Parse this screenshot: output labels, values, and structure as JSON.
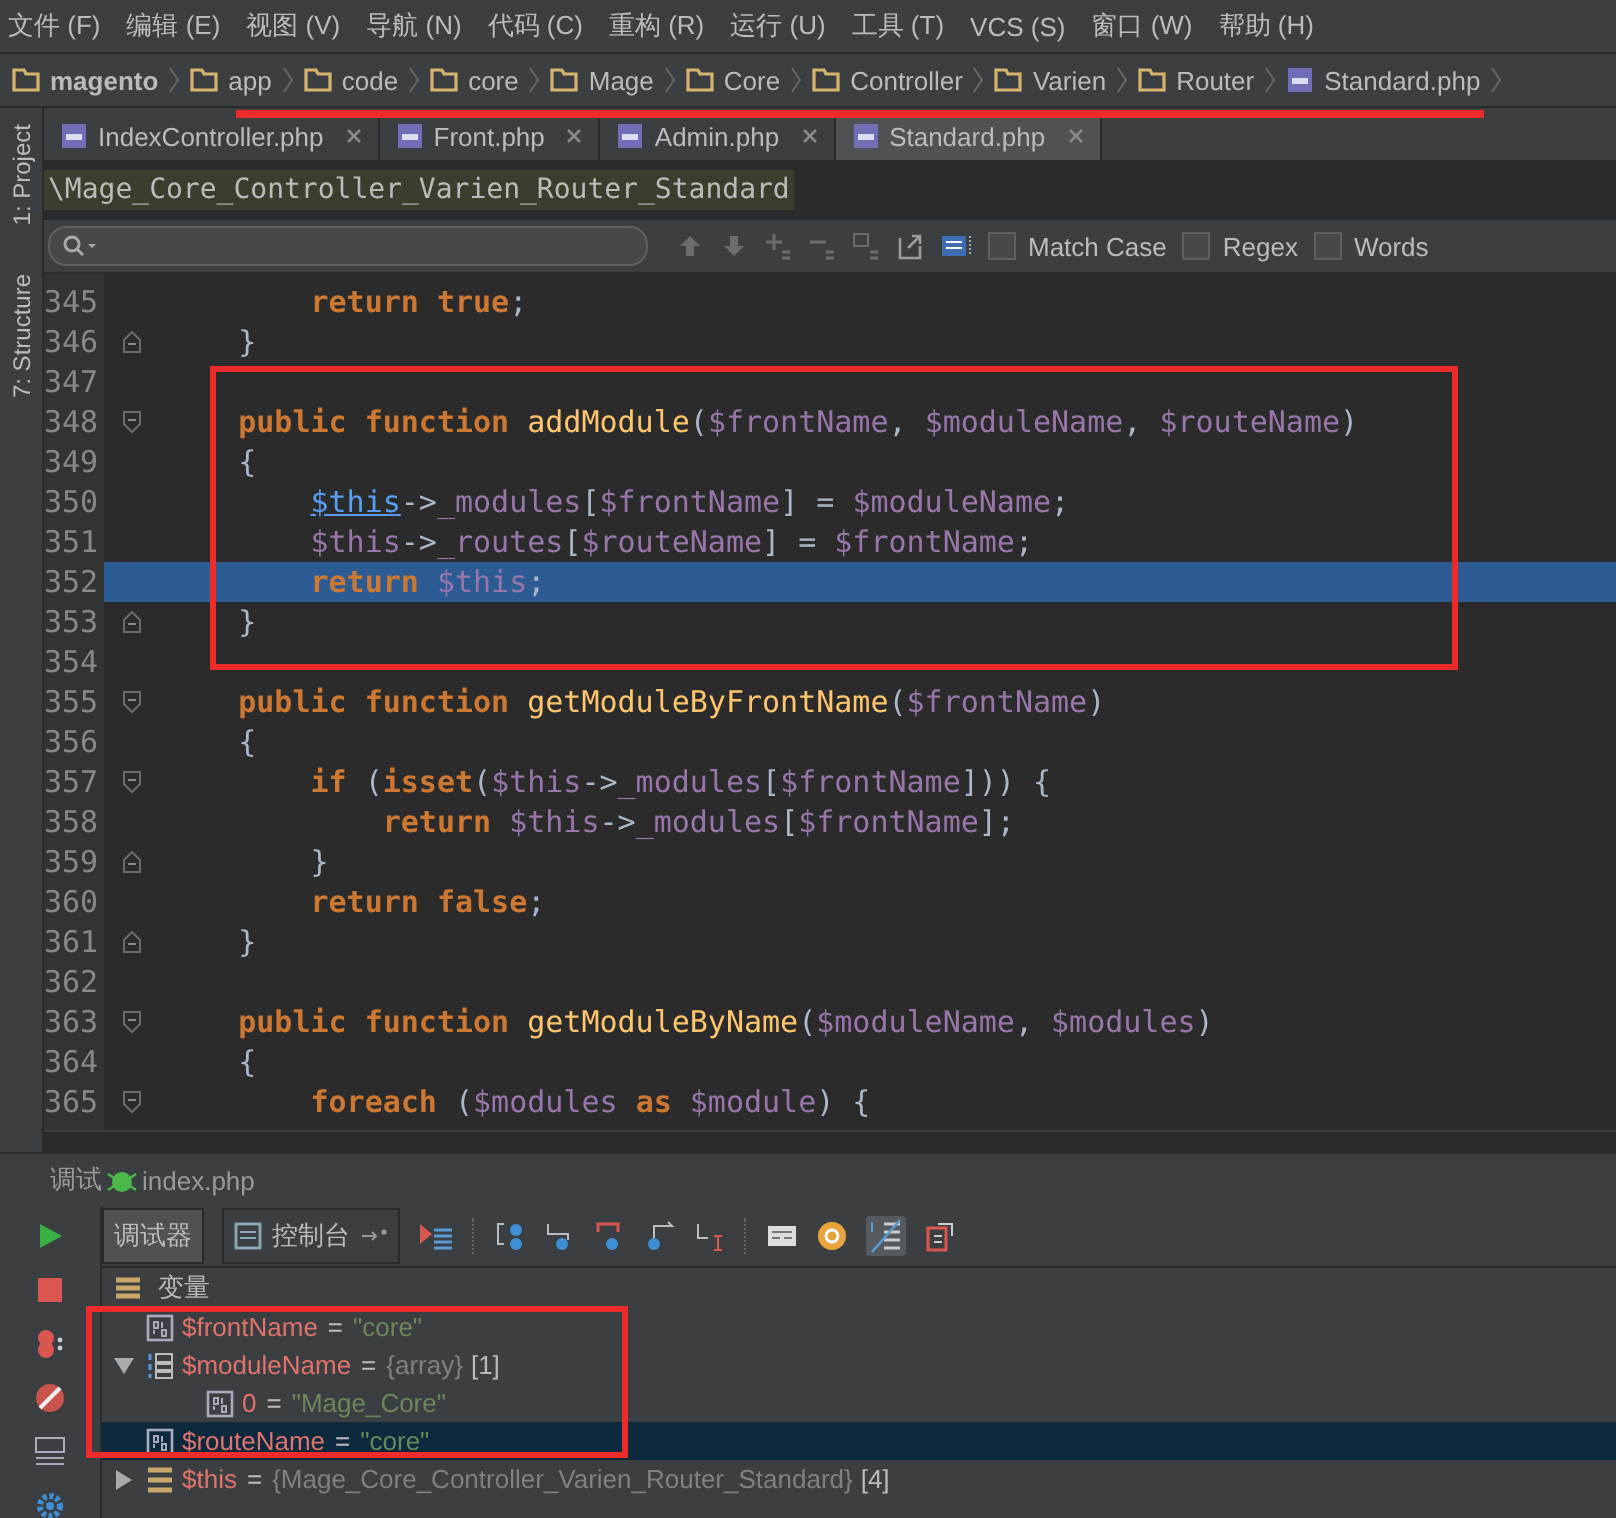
{
  "menu": [
    "文件 (F)",
    "编辑 (E)",
    "视图 (V)",
    "导航 (N)",
    "代码 (C)",
    "重构 (R)",
    "运行 (U)",
    "工具 (T)",
    "VCS (S)",
    "窗口 (W)",
    "帮助 (H)"
  ],
  "breadcrumbs": [
    {
      "label": "magento",
      "kind": "folder"
    },
    {
      "label": "app",
      "kind": "folder"
    },
    {
      "label": "code",
      "kind": "folder"
    },
    {
      "label": "core",
      "kind": "folder"
    },
    {
      "label": "Mage",
      "kind": "folder"
    },
    {
      "label": "Core",
      "kind": "folder"
    },
    {
      "label": "Controller",
      "kind": "folder"
    },
    {
      "label": "Varien",
      "kind": "folder"
    },
    {
      "label": "Router",
      "kind": "folder"
    },
    {
      "label": "Standard.php",
      "kind": "php"
    }
  ],
  "tool_windows": [
    "1: Project",
    "7: Structure"
  ],
  "tabs": [
    {
      "label": "IndexController.php",
      "selected": false
    },
    {
      "label": "Front.php",
      "selected": false
    },
    {
      "label": "Admin.php",
      "selected": false
    },
    {
      "label": "Standard.php",
      "selected": true
    }
  ],
  "class_path": "\\Mage_Core_Controller_Varien_Router_Standard",
  "find_options": [
    {
      "label": "Match Case",
      "checked": false
    },
    {
      "label": "Regex",
      "checked": false
    },
    {
      "label": "Words",
      "checked": false
    }
  ],
  "code": [
    {
      "number": "345",
      "current": false,
      "tokens": [
        {
          "kind": "kw",
          "text": "        return "
        },
        {
          "kind": "kw",
          "text": "true"
        },
        {
          "kind": "plain",
          "text": ";"
        }
      ]
    },
    {
      "number": "346",
      "current": false,
      "fold_end": true,
      "tokens": [
        {
          "kind": "plain",
          "text": "    }"
        }
      ]
    },
    {
      "number": "347",
      "current": false
    },
    {
      "number": "348",
      "current": false,
      "fold_start": true,
      "tokens": [
        {
          "kind": "kw",
          "text": "    public "
        },
        {
          "kind": "kw",
          "text": "function "
        },
        {
          "kind": "fn",
          "text": "addModule"
        },
        {
          "kind": "plain",
          "text": "("
        },
        {
          "kind": "var",
          "text": "$frontName"
        },
        {
          "kind": "plain",
          "text": ", "
        },
        {
          "kind": "var",
          "text": "$moduleName"
        },
        {
          "kind": "plain",
          "text": ", "
        },
        {
          "kind": "var",
          "text": "$routeName"
        },
        {
          "kind": "plain",
          "text": ")"
        }
      ]
    },
    {
      "number": "349",
      "current": false,
      "tokens": [
        {
          "kind": "plain",
          "text": "    {"
        }
      ]
    },
    {
      "number": "350",
      "current": false,
      "tokens": [
        {
          "kind": "link",
          "text": "        $this"
        },
        {
          "kind": "plain",
          "text": "->"
        },
        {
          "kind": "var",
          "text": "_modules"
        },
        {
          "kind": "plain",
          "text": "["
        },
        {
          "kind": "var",
          "text": "$frontName"
        },
        {
          "kind": "plain",
          "text": "] = "
        },
        {
          "kind": "var",
          "text": "$moduleName"
        },
        {
          "kind": "plain",
          "text": ";"
        }
      ]
    },
    {
      "number": "351",
      "current": false,
      "tokens": [
        {
          "kind": "var",
          "text": "        $this"
        },
        {
          "kind": "plain",
          "text": "->"
        },
        {
          "kind": "var",
          "text": "_routes"
        },
        {
          "kind": "plain",
          "text": "["
        },
        {
          "kind": "var",
          "text": "$routeName"
        },
        {
          "kind": "plain",
          "text": "] = "
        },
        {
          "kind": "var",
          "text": "$frontName"
        },
        {
          "kind": "plain",
          "text": ";"
        }
      ]
    },
    {
      "number": "352",
      "current": true,
      "tokens": [
        {
          "kind": "kw",
          "text": "        return "
        },
        {
          "kind": "var",
          "text": "$this"
        },
        {
          "kind": "plain",
          "text": ";"
        }
      ]
    },
    {
      "number": "353",
      "current": false,
      "fold_end": true,
      "tokens": [
        {
          "kind": "plain",
          "text": "    }"
        }
      ]
    },
    {
      "number": "354",
      "current": false
    },
    {
      "number": "355",
      "current": false,
      "fold_start": true,
      "tokens": [
        {
          "kind": "kw",
          "text": "    public "
        },
        {
          "kind": "kw",
          "text": "function "
        },
        {
          "kind": "fn",
          "text": "getModuleByFrontName"
        },
        {
          "kind": "plain",
          "text": "("
        },
        {
          "kind": "var",
          "text": "$frontName"
        },
        {
          "kind": "plain",
          "text": ")"
        }
      ]
    },
    {
      "number": "356",
      "current": false,
      "tokens": [
        {
          "kind": "plain",
          "text": "    {"
        }
      ]
    },
    {
      "number": "357",
      "current": false,
      "fold_start": true,
      "tokens": [
        {
          "kind": "kw",
          "text": "        if"
        },
        {
          "kind": "plain",
          "text": " ("
        },
        {
          "kind": "kw",
          "text": "isset"
        },
        {
          "kind": "plain",
          "text": "("
        },
        {
          "kind": "var",
          "text": "$this"
        },
        {
          "kind": "plain",
          "text": "->"
        },
        {
          "kind": "var",
          "text": "_modules"
        },
        {
          "kind": "plain",
          "text": "["
        },
        {
          "kind": "var",
          "text": "$frontName"
        },
        {
          "kind": "plain",
          "text": "])) {"
        }
      ]
    },
    {
      "number": "358",
      "current": false,
      "tokens": [
        {
          "kind": "kw",
          "text": "            return "
        },
        {
          "kind": "var",
          "text": "$this"
        },
        {
          "kind": "plain",
          "text": "->"
        },
        {
          "kind": "var",
          "text": "_modules"
        },
        {
          "kind": "plain",
          "text": "["
        },
        {
          "kind": "var",
          "text": "$frontName"
        },
        {
          "kind": "plain",
          "text": "];"
        }
      ]
    },
    {
      "number": "359",
      "current": false,
      "fold_end": true,
      "tokens": [
        {
          "kind": "plain",
          "text": "        }"
        }
      ]
    },
    {
      "number": "360",
      "current": false,
      "tokens": [
        {
          "kind": "kw",
          "text": "        return "
        },
        {
          "kind": "kw",
          "text": "false"
        },
        {
          "kind": "plain",
          "text": ";"
        }
      ]
    },
    {
      "number": "361",
      "current": false,
      "fold_end": true,
      "tokens": [
        {
          "kind": "plain",
          "text": "    }"
        }
      ]
    },
    {
      "number": "362",
      "current": false
    },
    {
      "number": "363",
      "current": false,
      "fold_start": true,
      "tokens": [
        {
          "kind": "kw",
          "text": "    public "
        },
        {
          "kind": "kw",
          "text": "function "
        },
        {
          "kind": "fn",
          "text": "getModuleByName"
        },
        {
          "kind": "plain",
          "text": "("
        },
        {
          "kind": "var",
          "text": "$moduleName"
        },
        {
          "kind": "plain",
          "text": ", "
        },
        {
          "kind": "var",
          "text": "$modules"
        },
        {
          "kind": "plain",
          "text": ")"
        }
      ]
    },
    {
      "number": "364",
      "current": false,
      "tokens": [
        {
          "kind": "plain",
          "text": "    {"
        }
      ]
    },
    {
      "number": "365",
      "current": false,
      "fold_start": true,
      "tokens": [
        {
          "kind": "kw",
          "text": "        foreach"
        },
        {
          "kind": "plain",
          "text": " ("
        },
        {
          "kind": "var",
          "text": "$modules "
        },
        {
          "kind": "kw",
          "text": "as "
        },
        {
          "kind": "var",
          "text": "$module"
        },
        {
          "kind": "plain",
          "text": ") {"
        }
      ]
    }
  ],
  "debug": {
    "title": "调试",
    "config": "index.php",
    "tabs": [
      {
        "label": "调试器",
        "selected": true
      },
      {
        "label": "控制台",
        "selected": false
      }
    ],
    "section": "变量",
    "variables": [
      {
        "kind": "scalar",
        "name": "$frontName",
        "operator": "=",
        "value": "\"core\"",
        "selected": false
      },
      {
        "kind": "array",
        "name": "$moduleName",
        "operator": "=",
        "type": "{array}",
        "count": "[1]",
        "expanded": true,
        "selected": false,
        "children": [
          {
            "kind": "scalar",
            "name": "0",
            "operator": "=",
            "value": "\"Mage_Core\"",
            "selected": false
          }
        ]
      },
      {
        "kind": "scalar",
        "name": "$routeName",
        "operator": "=",
        "value": "\"core\"",
        "selected": true
      },
      {
        "kind": "object",
        "name": "$this",
        "operator": "=",
        "type": "{Mage_Core_Controller_Varien_Router_Standard}",
        "count": "[4]",
        "expanded": false,
        "selected": false
      }
    ]
  }
}
